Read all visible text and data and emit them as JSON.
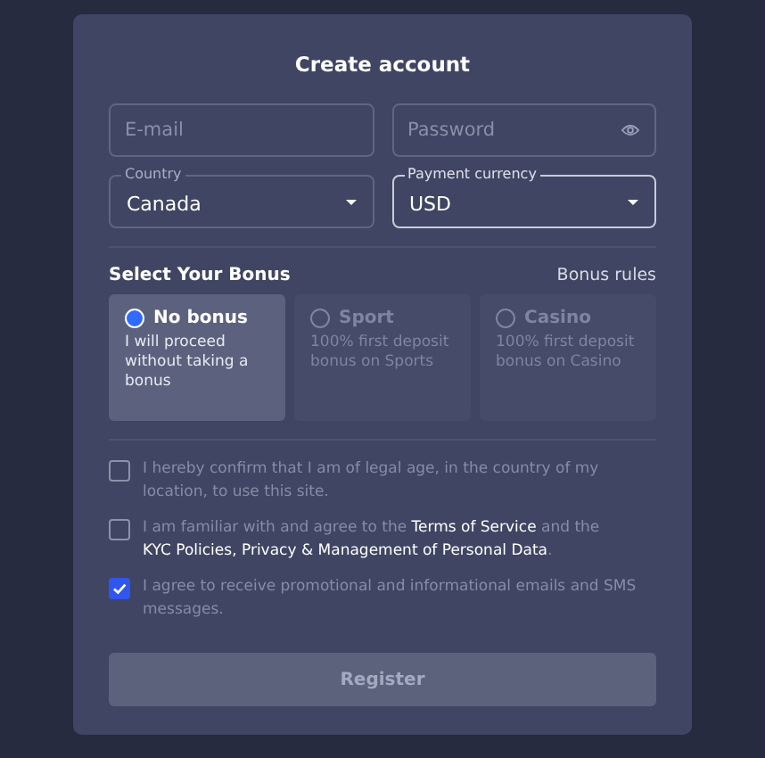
{
  "title": "Create account",
  "fields": [
    {
      "kind": "text",
      "placeholder": "E-mail"
    },
    {
      "kind": "password",
      "placeholder": "Password"
    }
  ],
  "selects": [
    {
      "label": "Country",
      "value": "Canada",
      "focused": false
    },
    {
      "label": "Payment currency",
      "value": "USD",
      "focused": true
    }
  ],
  "bonus": {
    "heading": "Select Your Bonus",
    "rules_link": "Bonus rules",
    "options": [
      {
        "title": "No bonus",
        "description": "I will proceed without taking a bonus",
        "selected": true
      },
      {
        "title": "Sport",
        "description": "100% first deposit bonus on Sports",
        "selected": false
      },
      {
        "title": "Casino",
        "description": "100% first deposit bonus on Casino",
        "selected": false
      }
    ]
  },
  "consents": [
    {
      "checked": false,
      "parts": [
        {
          "kind": "text",
          "text": "I hereby confirm that I am of legal age, in the country of my location, to use this site."
        }
      ]
    },
    {
      "checked": false,
      "parts": [
        {
          "kind": "text",
          "text": "I am familiar with and agree to the "
        },
        {
          "kind": "link",
          "text": "Terms of Service"
        },
        {
          "kind": "text",
          "text": " and the "
        },
        {
          "kind": "link",
          "text": "KYC Policies, Privacy & Management of Personal Data"
        },
        {
          "kind": "text",
          "text": "."
        }
      ]
    },
    {
      "checked": true,
      "parts": [
        {
          "kind": "text",
          "text": "I agree to receive promotional and informational emails and SMS messages."
        }
      ]
    }
  ],
  "register": {
    "label": "Register",
    "disabled": true
  }
}
